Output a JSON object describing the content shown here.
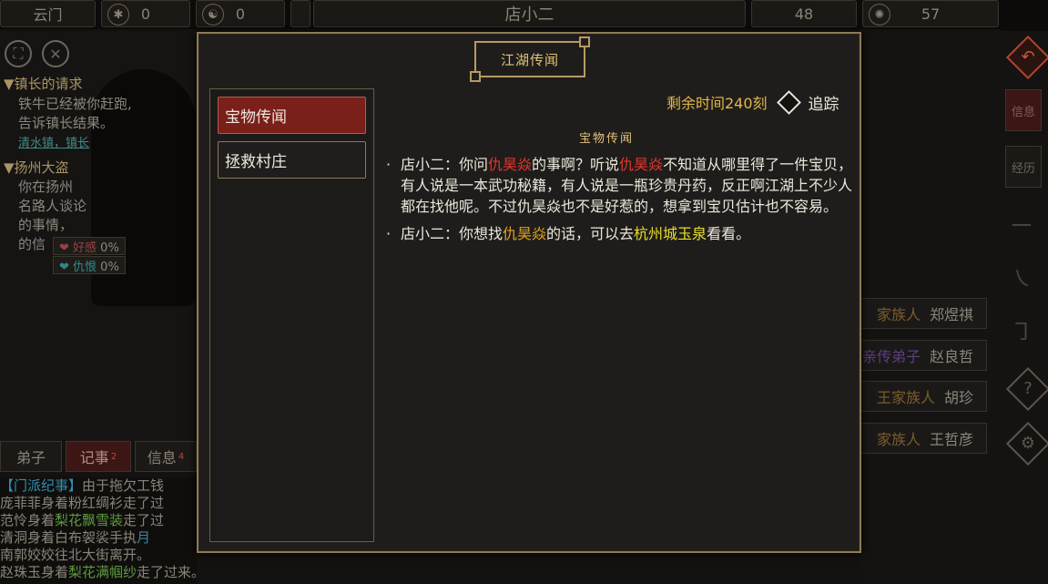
{
  "topbar": {
    "cell1": "云门",
    "cell2_value": "0",
    "cell3_value": "0",
    "center_title": "店小二",
    "cell5_value": "48",
    "cell6_value": "57"
  },
  "left_panel": {
    "quest1_title": "▼镇长的请求",
    "quest1_line1": "铁牛已经被你赶跑,",
    "quest1_line2": "告诉镇长结果。",
    "quest1_link": "清水镇，镇长",
    "quest2_title": "▼扬州大盗",
    "quest2_line1": "你在扬州",
    "quest2_line2": "名路人谈论",
    "quest2_line3": "的事情，",
    "quest2_line4": "的信",
    "stat_like_label": "❤ 好感",
    "stat_like_value": "0%",
    "stat_hate_label": "❤ 仇恨",
    "stat_hate_value": "0%"
  },
  "bottom_tabs": {
    "tab1": "弟子",
    "tab2": "记事",
    "tab2_badge": "2",
    "tab3": "信息",
    "tab3_badge": "4"
  },
  "log": {
    "line1_tag": "【门派纪事】",
    "line1_text": "由于拖欠工钱",
    "line2": "庞菲菲身着粉红绸衫走了过",
    "line3_a": "范怜身着",
    "line3_b": "梨花飘雪装",
    "line3_c": "走了过",
    "line4_a": "清洞身着白布袈裟手执",
    "line4_b": "月",
    "line5": "南郭姣姣往北大街离开。",
    "line6_a": "赵珠玉身着",
    "line6_b": "梨花满帼纱",
    "line6_c": "走了过来。"
  },
  "right_panel": {
    "cards": [
      {
        "tag": "家族人",
        "name": "郑煜祺"
      },
      {
        "tag": "亲传弟子",
        "name": "赵良哲"
      },
      {
        "tag": "王家族人",
        "name": "胡珍"
      },
      {
        "tag": "家族人",
        "name": "王哲彦"
      }
    ],
    "side_btn1": "信息",
    "side_btn2": "经历"
  },
  "modal": {
    "title": "江湖传闻",
    "list": [
      "宝物传闻",
      "拯救村庄"
    ],
    "timer_label": "剩余时间240刻",
    "track_label": "追踪",
    "section_title": "宝物传闻",
    "p1_a": "店小二：你问",
    "p1_b": "仇昊焱",
    "p1_c": "的事啊？听说",
    "p1_d": "仇昊焱",
    "p1_e": "不知道从哪里得了一件宝贝，有人说是一本武功秘籍，有人说是一瓶珍贵丹药，反正啊江湖上不少人都在找他呢。不过仇昊焱也不是好惹的，想拿到宝贝估计也不容易。",
    "p2_a": "店小二：你想找",
    "p2_b": "仇昊焱",
    "p2_c": "的话，可以去",
    "p2_d": "杭州城玉泉",
    "p2_e": "看看。"
  }
}
